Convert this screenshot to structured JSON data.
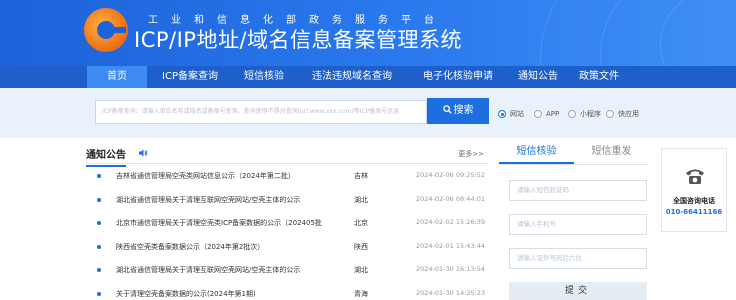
{
  "header": {
    "subtitle": "工业和信息化部政务服务平台",
    "title": "ICP/IP地址/域名信息备案管理系统",
    "brand_color": "#1d62d8",
    "logo_icon": "miit-logo-icon"
  },
  "nav": {
    "items": [
      {
        "label": "首页",
        "active": true
      },
      {
        "label": "ICP备案查询",
        "active": false
      },
      {
        "label": "短信核验",
        "active": false
      },
      {
        "label": "违法违规域名查询",
        "active": false
      },
      {
        "label": "电子化核验申请",
        "active": false
      },
      {
        "label": "通知公告",
        "active": false
      },
      {
        "label": "政策文件",
        "active": false
      }
    ]
  },
  "search": {
    "placeholder": "ICP备案查询：请输入单位名称或域名或备案号查询，查询使用不得对查询(url:www.xxx.com)等ICP备案号信息",
    "button_label": "搜索",
    "button_icon": "search-icon",
    "options": [
      {
        "label": "网站",
        "checked": true
      },
      {
        "label": "APP",
        "checked": false
      },
      {
        "label": "小程序",
        "checked": false
      },
      {
        "label": "快应用",
        "checked": false
      }
    ]
  },
  "notices": {
    "title": "通知公告",
    "more_label": "更多>>",
    "items": [
      {
        "text": "吉林省通信管理局空壳类网站信息公示（2024年第二批）",
        "province": "吉林",
        "date": "2024-02-06 09:25:52"
      },
      {
        "text": "湖北省通信管理局关于清理互联网空壳网站/空壳主体的公示",
        "province": "湖北",
        "date": "2024-02-06 08:44:01"
      },
      {
        "text": "北京市通信管理局关于清理空壳类ICP备案数据的公示（202405批",
        "province": "北京",
        "date": "2024-02-02 15:26:39"
      },
      {
        "text": "陕西省空壳类备案数据公示（2024年第2批次）",
        "province": "陕西",
        "date": "2024-02-01 15:43:44"
      },
      {
        "text": "湖北省通信管理局关于清理互联网空壳网站/空壳主体的公示",
        "province": "湖北",
        "date": "2024-01-30 16:13:54"
      },
      {
        "text": "关于清理空壳备案数据的公示(2024年第1期)",
        "province": "青海",
        "date": "2024-01-30 14:35:23"
      }
    ]
  },
  "sms": {
    "tabs": [
      {
        "label": "短信核验",
        "active": true
      },
      {
        "label": "短信重发",
        "active": false
      }
    ],
    "fields": [
      {
        "placeholder": "请输入短信验证码"
      },
      {
        "placeholder": "请输入手机号"
      },
      {
        "placeholder": "请输入证件号码后六位"
      }
    ],
    "submit_label": "提交"
  },
  "hotline": {
    "icon": "phone-icon",
    "label": "全国咨询电话",
    "number": "010-66411166"
  }
}
